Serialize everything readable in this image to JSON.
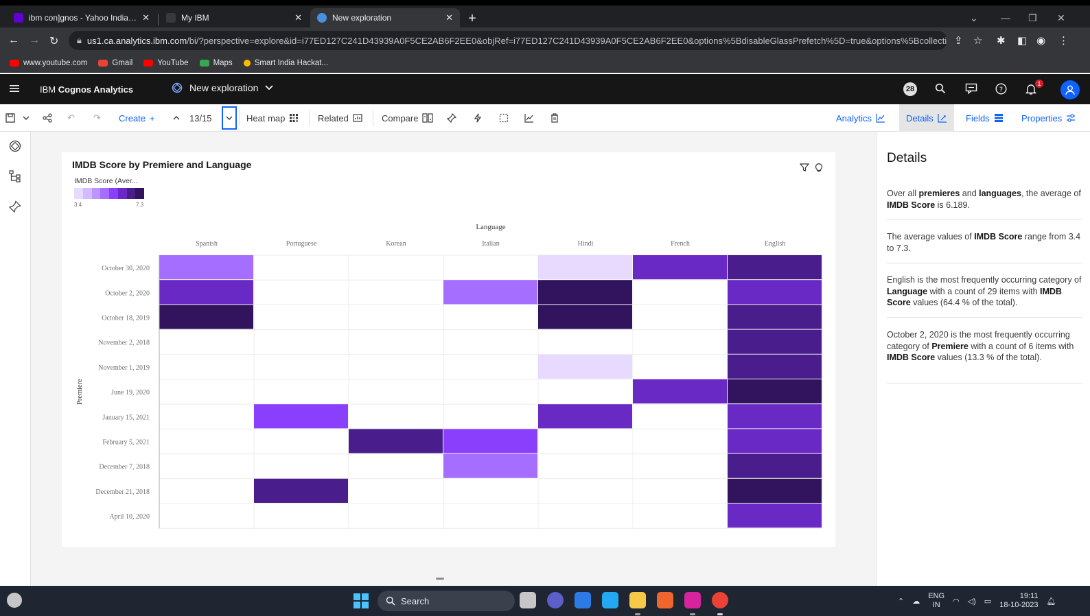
{
  "browser": {
    "tabs": [
      {
        "label": "ibm con]gnos - Yahoo India Sea",
        "color": "#6001d2",
        "active": false
      },
      {
        "label": "My IBM",
        "color": "#000000",
        "active": false
      },
      {
        "label": "New exploration",
        "color": "#4a90e2",
        "active": true
      }
    ],
    "url_host": "us1.ca.analytics.ibm.com",
    "url_rest": "/bi/?perspective=explore&id=i77ED127C241D43939A0F5CE2AB6F2EE0&objRef=i77ED127C241D43939A0F5CE2AB6F2EE0&options%5BdisableGlassPrefetch%5D=true&options%5Bcollections%5...",
    "bookmarks": [
      {
        "label": "www.youtube.com",
        "color": "#ff0000"
      },
      {
        "label": "Gmail",
        "color": "#ea4335"
      },
      {
        "label": "YouTube",
        "color": "#ff0000"
      },
      {
        "label": "Maps",
        "color": "#34a853"
      },
      {
        "label": "Smart India Hackat...",
        "color": "#fbbc04"
      }
    ]
  },
  "app": {
    "brand_prefix": "IBM",
    "brand_name": "Cognos Analytics",
    "exploration_title": "New exploration",
    "notification_count": "28",
    "alert_count": "1"
  },
  "toolbar": {
    "create": "Create",
    "page_indicator": "13/15",
    "heatmap": "Heat map",
    "related": "Related",
    "compare": "Compare",
    "panel_tabs": [
      "Analytics",
      "Details",
      "Fields",
      "Properties"
    ]
  },
  "chart_data": {
    "type": "heatmap",
    "title": "IMDB Score by Premiere and Language",
    "legend_title": "IMDB Score (Aver...",
    "legend_min": "3.4",
    "legend_max": "7.3",
    "range": [
      3.4,
      7.3
    ],
    "xlabel": "Language",
    "ylabel": "Premiere",
    "x": [
      "Spanish",
      "Portuguese",
      "Korean",
      "Italian",
      "Hindi",
      "French",
      "English"
    ],
    "y": [
      "October 30, 2020",
      "October 2, 2020",
      "October 18, 2019",
      "November 2, 2018",
      "November 1, 2019",
      "June 19, 2020",
      "January 15, 2021",
      "February 5, 2021",
      "December 7, 2018",
      "December 21, 2018",
      "April 10, 2020"
    ],
    "values": [
      [
        5.0,
        null,
        null,
        null,
        3.6,
        6.2,
        6.6
      ],
      [
        6.0,
        null,
        null,
        5.0,
        6.9,
        null,
        6.3
      ],
      [
        7.3,
        null,
        null,
        null,
        6.9,
        null,
        6.5
      ],
      [
        null,
        null,
        null,
        null,
        null,
        null,
        6.6
      ],
      [
        null,
        null,
        null,
        null,
        3.6,
        null,
        6.6
      ],
      [
        null,
        null,
        null,
        null,
        null,
        6.2,
        7.1
      ],
      [
        null,
        5.7,
        null,
        null,
        6.2,
        null,
        6.0
      ],
      [
        null,
        null,
        6.7,
        5.8,
        null,
        null,
        6.0
      ],
      [
        null,
        null,
        null,
        4.9,
        null,
        null,
        6.5
      ],
      [
        null,
        6.5,
        null,
        null,
        null,
        null,
        7.1
      ],
      [
        null,
        null,
        null,
        null,
        null,
        null,
        6.0
      ]
    ]
  },
  "details": {
    "title": "Details",
    "insights": [
      [
        {
          "t": "Over all "
        },
        {
          "t": "premieres",
          "b": true
        },
        {
          "t": " and "
        },
        {
          "t": "languages",
          "b": true
        },
        {
          "t": ", the average of "
        },
        {
          "t": "IMDB Score",
          "b": true
        },
        {
          "t": " is 6.189."
        }
      ],
      [
        {
          "t": "The average values of "
        },
        {
          "t": "IMDB Score",
          "b": true
        },
        {
          "t": " range from 3.4 to 7.3."
        }
      ],
      [
        {
          "t": "English is the most frequently occurring category of "
        },
        {
          "t": "Language",
          "b": true
        },
        {
          "t": " with a count of 29 items with "
        },
        {
          "t": "IMDB Score",
          "b": true
        },
        {
          "t": " values (64.4 % of the total)."
        }
      ],
      [
        {
          "t": "October 2, 2020 is the most frequently occurring category of "
        },
        {
          "t": "Premiere",
          "b": true
        },
        {
          "t": " with a count of 6 items with "
        },
        {
          "t": "IMDB Score",
          "b": true
        },
        {
          "t": " values (13.3 % of the total)."
        }
      ]
    ]
  },
  "taskbar": {
    "search": "Search",
    "lang_top": "ENG",
    "lang_bottom": "IN",
    "time": "19:11",
    "date": "18-10-2023"
  },
  "colors": {
    "accent": "#0f62fe",
    "scale": [
      "#e8daff",
      "#d4bbff",
      "#be95ff",
      "#a56eff",
      "#8a3ffc",
      "#6929c4",
      "#491d8b",
      "#31135e"
    ]
  }
}
